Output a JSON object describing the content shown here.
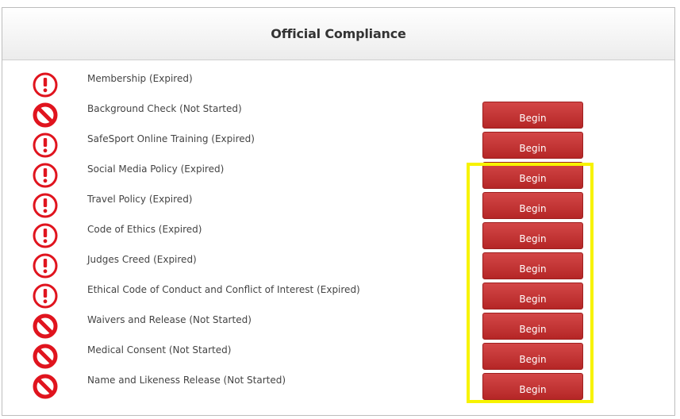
{
  "panel": {
    "title": "Official Compliance"
  },
  "rows": [
    {
      "label": "Membership (Expired)",
      "status": "expired",
      "icon": "exclamation-circle-icon",
      "has_button": false
    },
    {
      "label": "Background Check (Not Started)",
      "status": "not-started",
      "icon": "prohibited-icon",
      "has_button": true,
      "button_label": "Begin"
    },
    {
      "label": "SafeSport Online Training (Expired)",
      "status": "expired",
      "icon": "exclamation-circle-icon",
      "has_button": true,
      "button_label": "Begin"
    },
    {
      "label": "Social Media Policy (Expired)",
      "status": "expired",
      "icon": "exclamation-circle-icon",
      "has_button": true,
      "button_label": "Begin"
    },
    {
      "label": "Travel Policy (Expired)",
      "status": "expired",
      "icon": "exclamation-circle-icon",
      "has_button": true,
      "button_label": "Begin"
    },
    {
      "label": "Code of Ethics (Expired)",
      "status": "expired",
      "icon": "exclamation-circle-icon",
      "has_button": true,
      "button_label": "Begin"
    },
    {
      "label": "Judges Creed (Expired)",
      "status": "expired",
      "icon": "exclamation-circle-icon",
      "has_button": true,
      "button_label": "Begin"
    },
    {
      "label": "Ethical Code of Conduct and Conflict of Interest (Expired)",
      "status": "expired",
      "icon": "exclamation-circle-icon",
      "has_button": true,
      "button_label": "Begin"
    },
    {
      "label": "Waivers and Release (Not Started)",
      "status": "not-started",
      "icon": "prohibited-icon",
      "has_button": true,
      "button_label": "Begin"
    },
    {
      "label": "Medical Consent (Not Started)",
      "status": "not-started",
      "icon": "prohibited-icon",
      "has_button": true,
      "button_label": "Begin"
    },
    {
      "label": "Name and Likeness Release (Not Started)",
      "status": "not-started",
      "icon": "prohibited-icon",
      "has_button": true,
      "button_label": "Begin"
    }
  ],
  "colors": {
    "status_red": "#e0141e",
    "button_red": "#c43131",
    "highlight_yellow": "#f7f300"
  }
}
